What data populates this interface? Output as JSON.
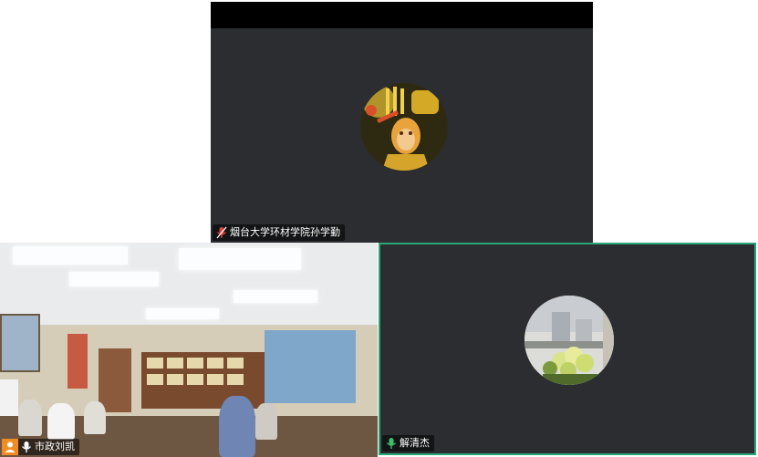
{
  "tiles": {
    "top": {
      "name": "烟台大学环材学院孙学勤",
      "mic_state": "muted",
      "avatar": "monkey-king-avatar"
    },
    "bottom_left": {
      "name": "市政刘凯",
      "mic_state": "active",
      "video": "meeting-room-video"
    },
    "bottom_right": {
      "name": "解清杰",
      "mic_state": "active",
      "avatar": "flowers-window-avatar",
      "active_speaker": true
    }
  },
  "colors": {
    "tile_bg": "#2b2d30",
    "active_border": "#2aa777",
    "muted_mic": "#e0443a",
    "active_mic": "#39c16c",
    "user_badge": "#f08c22"
  }
}
